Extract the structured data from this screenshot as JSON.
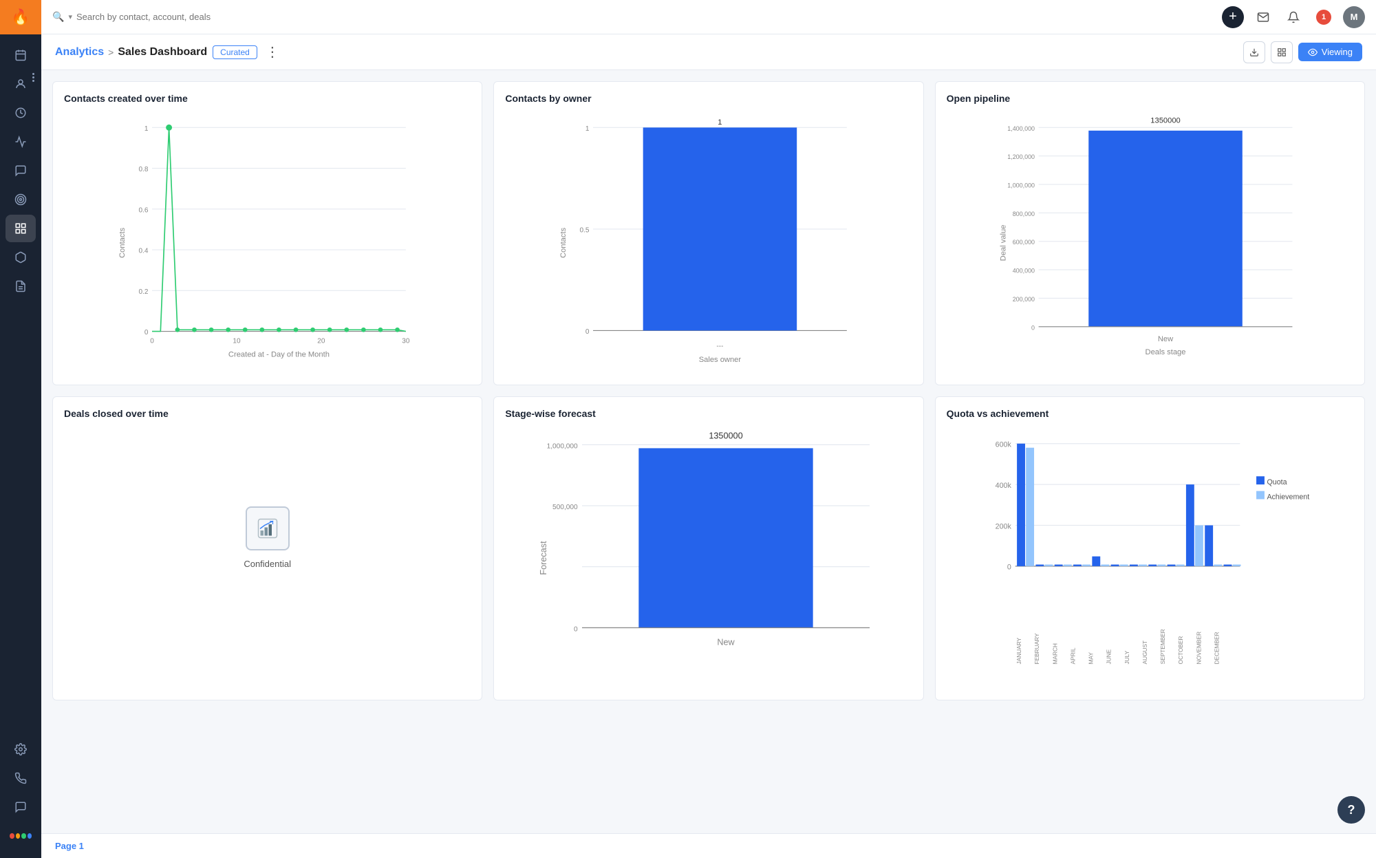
{
  "topnav": {
    "search_placeholder": "Search by contact, account, deals",
    "add_label": "+",
    "notification_count": "1",
    "avatar_label": "M"
  },
  "header": {
    "analytics_link": "Analytics",
    "breadcrumb_sep": ">",
    "dashboard_title": "Sales Dashboard",
    "curated_label": "Curated",
    "more_icon": "⋮",
    "download_icon": "⬇",
    "layout_icon": "▦",
    "viewing_label": "Viewing",
    "eye_icon": "👁"
  },
  "sidebar": {
    "logo_icon": "🔥",
    "items": [
      {
        "icon": "📅",
        "label": "Calendar"
      },
      {
        "icon": "👤",
        "label": "Contacts"
      },
      {
        "icon": "💰",
        "label": "Deals"
      },
      {
        "icon": "📈",
        "label": "Analytics"
      },
      {
        "icon": "💬",
        "label": "Conversations"
      },
      {
        "icon": "🎯",
        "label": "Goals"
      },
      {
        "icon": "🏆",
        "label": "Sequences"
      },
      {
        "icon": "📦",
        "label": "Products"
      },
      {
        "icon": "📋",
        "label": "Reports"
      }
    ],
    "bottom_items": [
      {
        "icon": "⚙️",
        "label": "Settings"
      },
      {
        "icon": "📞",
        "label": "Phone"
      },
      {
        "icon": "💬",
        "label": "Chat"
      },
      {
        "icon": "🎨",
        "label": "Apps"
      }
    ]
  },
  "charts": {
    "contacts_over_time": {
      "title": "Contacts created over time",
      "x_label": "Created at - Day of the Month",
      "y_label": "Contacts",
      "x_ticks": [
        "0",
        "10",
        "20",
        "30"
      ],
      "y_ticks": [
        "0",
        "0.2",
        "0.4",
        "0.6",
        "0.8",
        "1"
      ]
    },
    "contacts_by_owner": {
      "title": "Contacts by owner",
      "x_label": "Sales owner",
      "y_label": "Contacts",
      "bar_value": "1",
      "bar_label": "---",
      "y_ticks": [
        "0",
        "1"
      ],
      "bar_color": "#2563eb"
    },
    "open_pipeline": {
      "title": "Open pipeline",
      "x_label": "Deals stage",
      "y_label": "Deal value",
      "bar_value": "1350000",
      "bar_label": "New",
      "y_ticks": [
        "0",
        "200,000",
        "400,000",
        "600,000",
        "800,000",
        "1,000,000",
        "1,200,000",
        "1,400,000"
      ],
      "bar_color": "#2563eb"
    },
    "deals_closed": {
      "title": "Deals closed over time",
      "confidential_text": "Confidential"
    },
    "stage_wise_forecast": {
      "title": "Stage-wise forecast",
      "x_label": "New",
      "y_label": "Forecast",
      "bar_value": "1350000",
      "y_ticks": [
        "0",
        "500,000",
        "1,000,000"
      ],
      "bar_color": "#2563eb"
    },
    "quota_vs_achievement": {
      "title": "Quota vs achievement",
      "legend": [
        {
          "label": "Quota",
          "color": "#2563eb"
        },
        {
          "label": "Achievement",
          "color": "#93c5fd"
        }
      ],
      "months": [
        "JANUARY",
        "FEBRUARY",
        "MARCH",
        "APRIL",
        "MAY",
        "JUNE",
        "JULY",
        "AUGUST",
        "SEPTEMBER",
        "OCTOBER",
        "NOVEMBER",
        "DECEMBER"
      ],
      "y_ticks": [
        "0",
        "200k",
        "400k",
        "600k"
      ],
      "quota_color": "#2563eb",
      "achievement_color": "#93c5fd"
    }
  },
  "footer": {
    "page_label": "Page 1"
  }
}
